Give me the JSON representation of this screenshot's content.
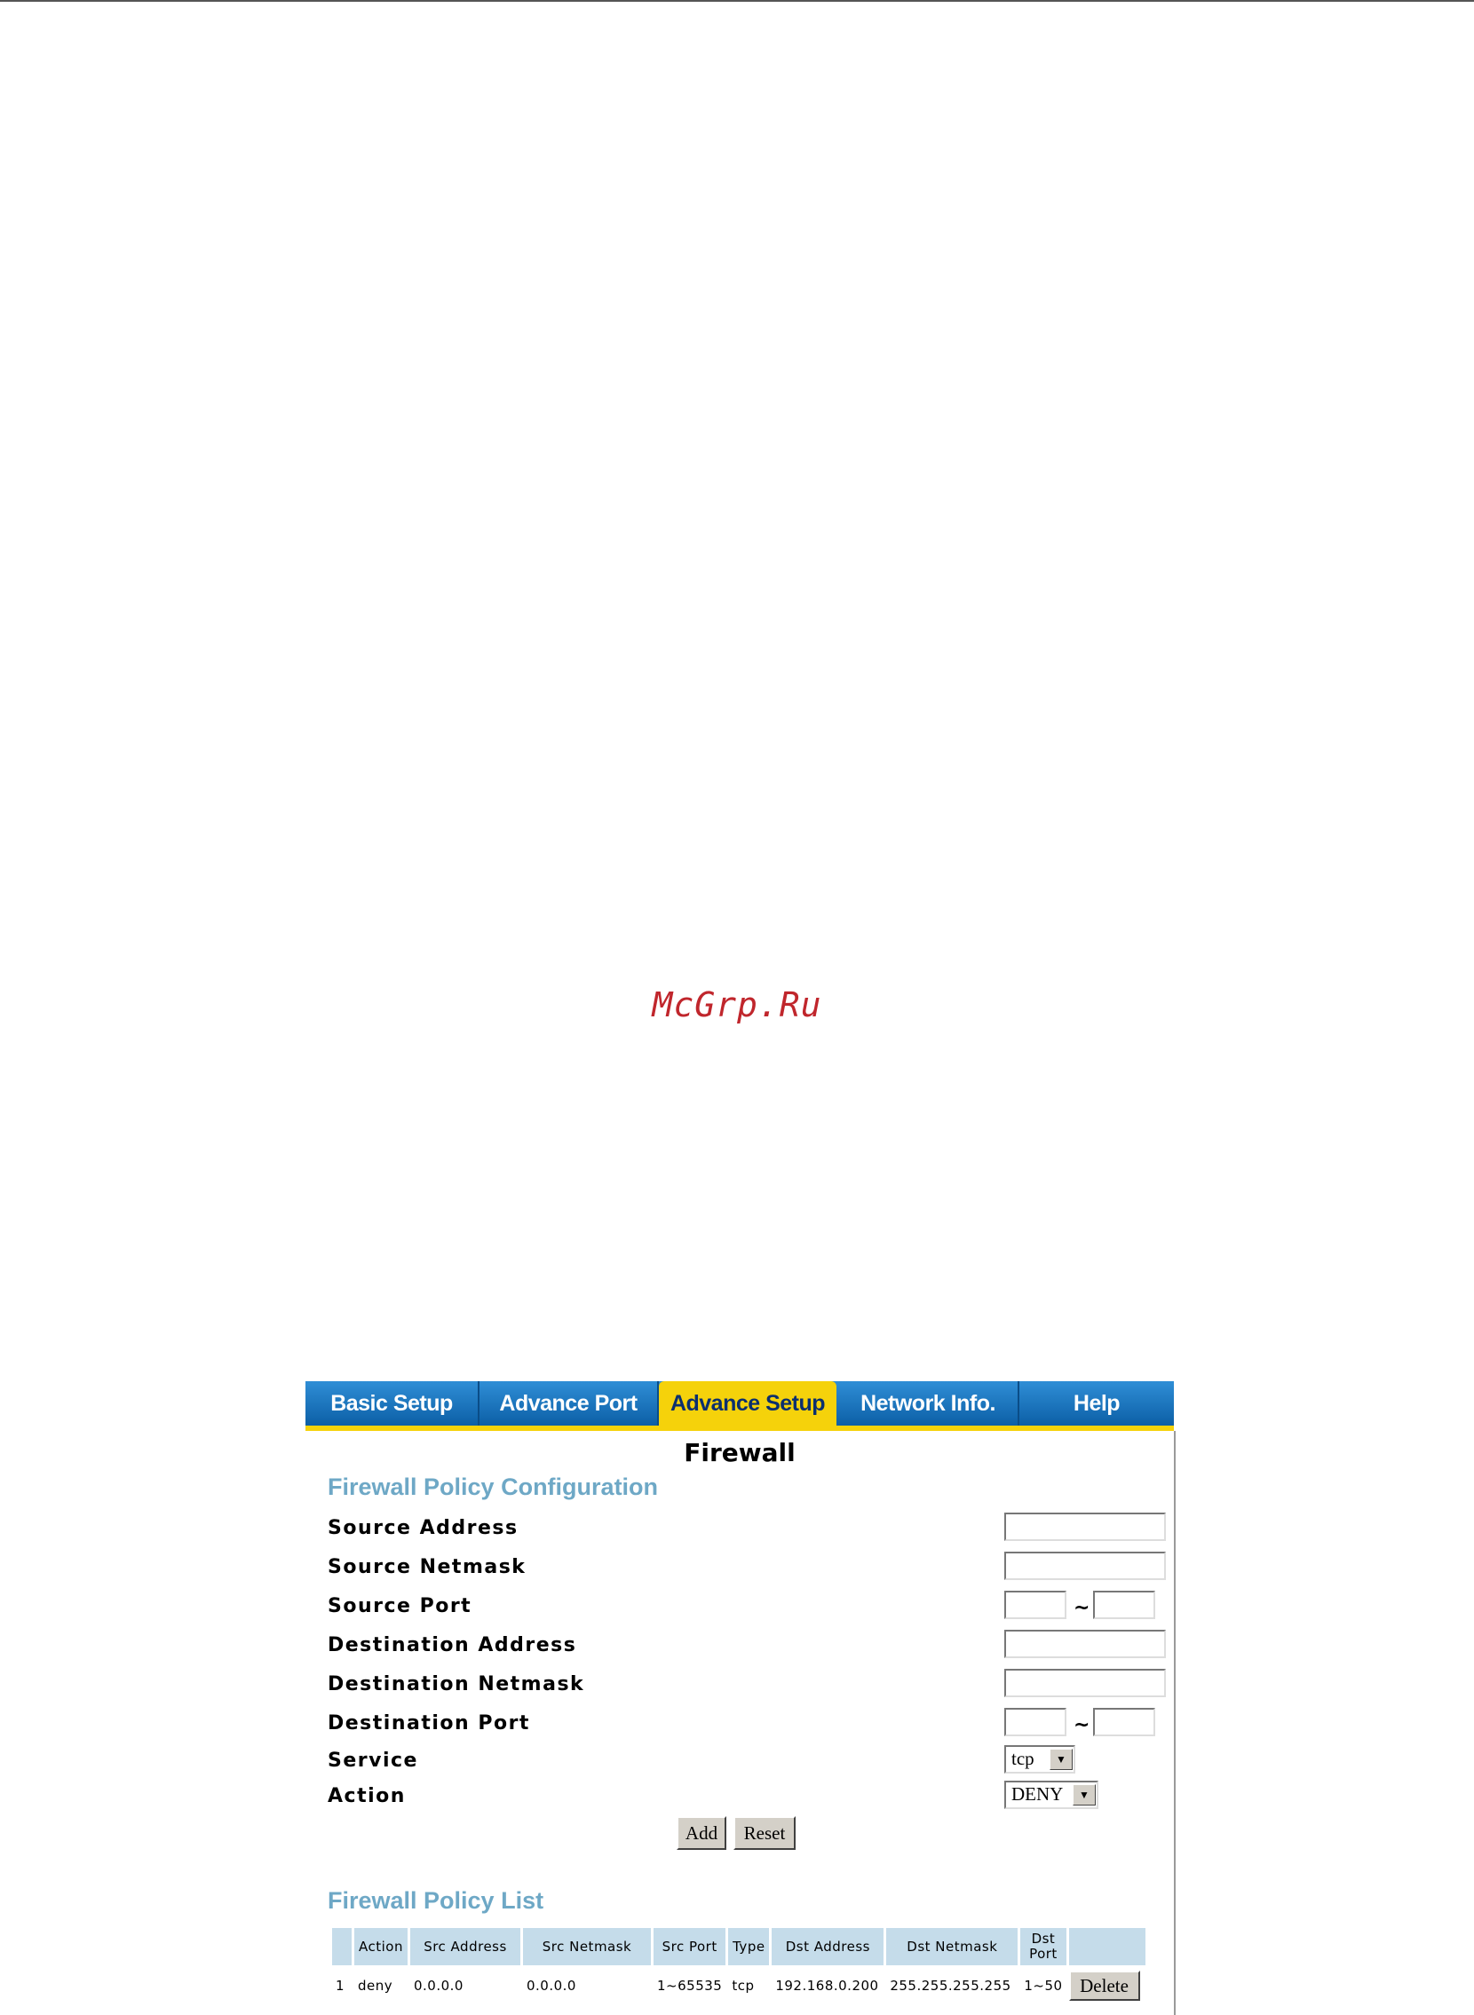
{
  "watermark": "McGrp.Ru",
  "tabs": [
    {
      "label": "Basic Setup",
      "active": false
    },
    {
      "label": "Advance Port",
      "active": false
    },
    {
      "label": "Advance Setup",
      "active": true
    },
    {
      "label": "Network Info.",
      "active": false
    },
    {
      "label": "Help",
      "active": false
    }
  ],
  "page_title": "Firewall",
  "config": {
    "title": "Firewall Policy Configuration",
    "source_address_label": "Source Address",
    "source_address_value": "",
    "source_netmask_label": "Source Netmask",
    "source_netmask_value": "",
    "source_port_label": "Source Port",
    "source_port_from": "",
    "source_port_to": "",
    "destination_address_label": "Destination Address",
    "destination_address_value": "",
    "destination_netmask_label": "Destination Netmask",
    "destination_netmask_value": "",
    "destination_port_label": "Destination Port",
    "destination_port_from": "",
    "destination_port_to": "",
    "range_separator": "~",
    "service_label": "Service",
    "service_value": "tcp",
    "action_label": "Action",
    "action_value": "DENY",
    "add_label": "Add",
    "reset_label": "Reset"
  },
  "list": {
    "title": "Firewall Policy List",
    "columns": [
      "",
      "Action",
      "Src Address",
      "Src Netmask",
      "Src Port",
      "Type",
      "Dst Address",
      "Dst Netmask",
      "Dst Port",
      ""
    ],
    "rows": [
      {
        "index": "1",
        "action": "deny",
        "src_address": "0.0.0.0",
        "src_netmask": "0.0.0.0",
        "src_port": "1~65535",
        "type": "tcp",
        "dst_address": "192.168.0.200",
        "dst_netmask": "255.255.255.255",
        "dst_port": "1~50",
        "delete_label": "Delete"
      }
    ]
  }
}
